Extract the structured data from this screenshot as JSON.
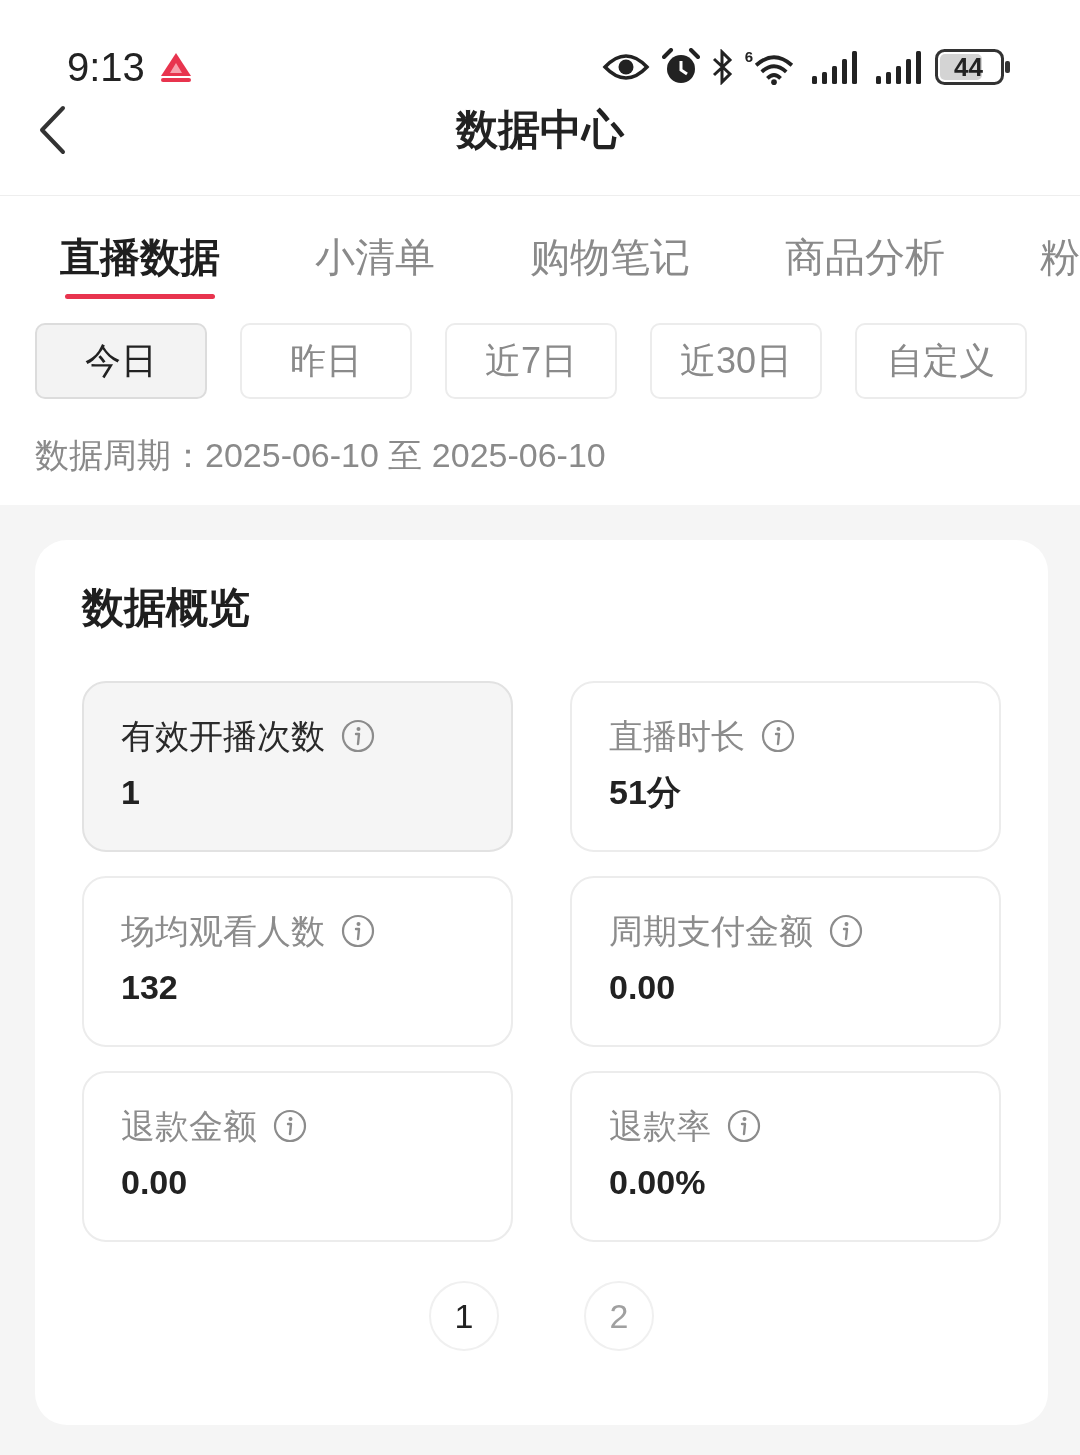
{
  "status_bar": {
    "time": "9:13",
    "wifi_label": "6",
    "battery": "44"
  },
  "nav": {
    "title": "数据中心"
  },
  "tabs": [
    {
      "label": "直播数据",
      "selected": true
    },
    {
      "label": "小清单",
      "selected": false
    },
    {
      "label": "购物笔记",
      "selected": false
    },
    {
      "label": "商品分析",
      "selected": false
    },
    {
      "label": "粉",
      "selected": false
    }
  ],
  "periods": [
    {
      "label": "今日",
      "selected": true
    },
    {
      "label": "昨日",
      "selected": false
    },
    {
      "label": "近7日",
      "selected": false
    },
    {
      "label": "近30日",
      "selected": false
    },
    {
      "label": "自定义",
      "selected": false
    }
  ],
  "date_range": "数据周期：2025-06-10 至 2025-06-10",
  "overview": {
    "title": "数据概览",
    "metrics": [
      {
        "label": "有效开播次数",
        "value": "1",
        "selected": true
      },
      {
        "label": "直播时长",
        "value": "51分",
        "selected": false
      },
      {
        "label": "场均观看人数",
        "value": "132",
        "selected": false
      },
      {
        "label": "周期支付金额",
        "value": "0.00",
        "selected": false
      },
      {
        "label": "退款金额",
        "value": "0.00",
        "selected": false
      },
      {
        "label": "退款率",
        "value": "0.00%",
        "selected": false
      }
    ],
    "pages": [
      {
        "label": "1",
        "selected": true
      },
      {
        "label": "2",
        "selected": false
      }
    ]
  }
}
